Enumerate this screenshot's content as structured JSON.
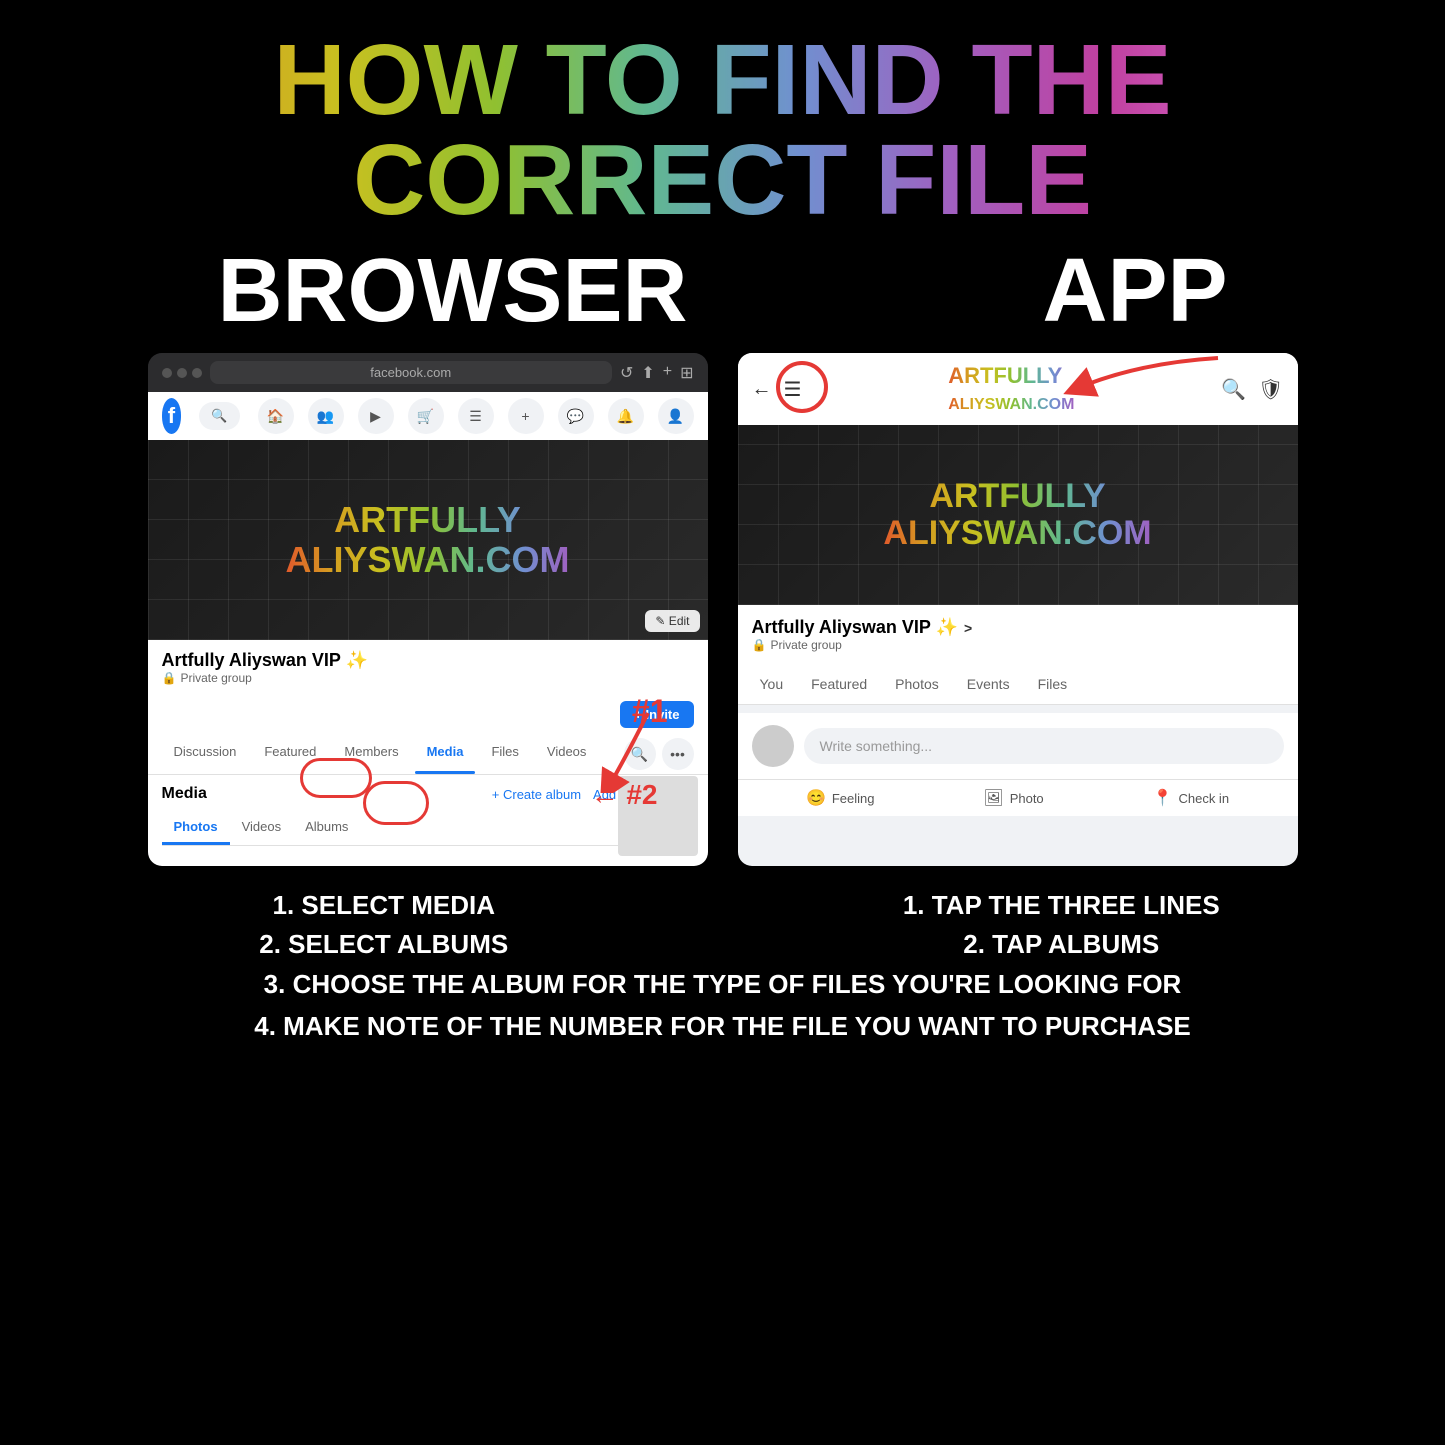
{
  "page": {
    "background": "#000000"
  },
  "title": {
    "line1": "HOW TO FIND THE CORRECT FILE"
  },
  "columns": {
    "browser_label": "BROWSER",
    "app_label": "APP"
  },
  "browser": {
    "url": "facebook.com",
    "group_name": "Artfully Aliyswan VIP ✨",
    "private_label": "Private group",
    "invite_btn": "+ Invite",
    "tabs": [
      "Discussion",
      "Featured",
      "Members",
      "Media",
      "Files",
      "Videos"
    ],
    "active_tab": "Media",
    "media_title": "Media",
    "create_album": "+ Create album",
    "add_photos": "Add photos/video",
    "subtabs": [
      "Photos",
      "Videos",
      "Albums"
    ],
    "active_subtab": "Photos",
    "edit_btn": "✎ Edit"
  },
  "app": {
    "group_name": "Artfully Aliyswan VIP ✨",
    "chevron": ">",
    "private_label": "Private group",
    "tabs": [
      "You",
      "Featured",
      "Photos",
      "Events",
      "Files"
    ],
    "compose_placeholder": "Write something...",
    "actions": [
      {
        "icon": "😊",
        "label": "Feeling"
      },
      {
        "icon": "🖼",
        "label": "Photo"
      },
      {
        "icon": "📍",
        "label": "Check in"
      }
    ]
  },
  "annotations": {
    "number1": "#1",
    "number2": "#2",
    "arrow_note": "← #2"
  },
  "instructions": {
    "browser": {
      "line1": "1. SELECT MEDIA",
      "line2": "2. SELECT ALBUMS",
      "line3": "3. CHOOSE THE ALBUM FOR THE TYPE OF FILES YOU'RE LOOKING FOR",
      "line4": "4. MAKE NOTE OF THE NUMBER FOR THE FILE YOU WANT TO PURCHASE"
    },
    "app": {
      "line1": "1. TAP THE THREE LINES",
      "line2": "2. TAP ALBUMS"
    }
  }
}
